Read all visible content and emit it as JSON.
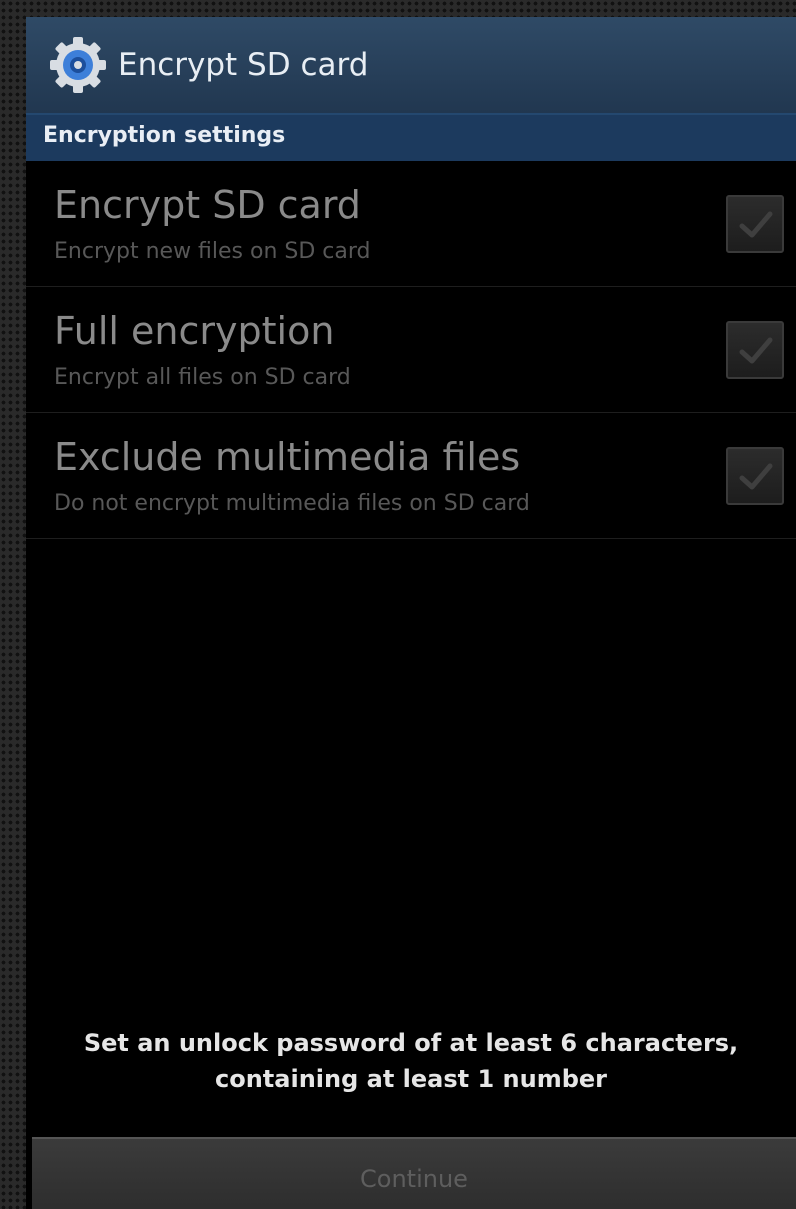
{
  "title_bar": {
    "icon": "gear-icon",
    "title": "Encrypt SD card"
  },
  "section_header": "Encryption settings",
  "settings": [
    {
      "title": "Encrypt SD card",
      "subtitle": "Encrypt new files on SD card",
      "checked": true,
      "enabled": false
    },
    {
      "title": "Full encryption",
      "subtitle": "Encrypt all files on SD card",
      "checked": true,
      "enabled": false
    },
    {
      "title": "Exclude multimedia files",
      "subtitle": "Do not encrypt multimedia files on SD card",
      "checked": true,
      "enabled": false
    }
  ],
  "notice": {
    "line1": "Set an unlock password of at least 6 characters,",
    "line2": "containing at least 1 number"
  },
  "continue_button": {
    "label": "Continue",
    "enabled": false
  },
  "colors": {
    "title_bar": "#213750",
    "section_header": "#1c3a5e",
    "gear_accent": "#3d7fd9"
  }
}
